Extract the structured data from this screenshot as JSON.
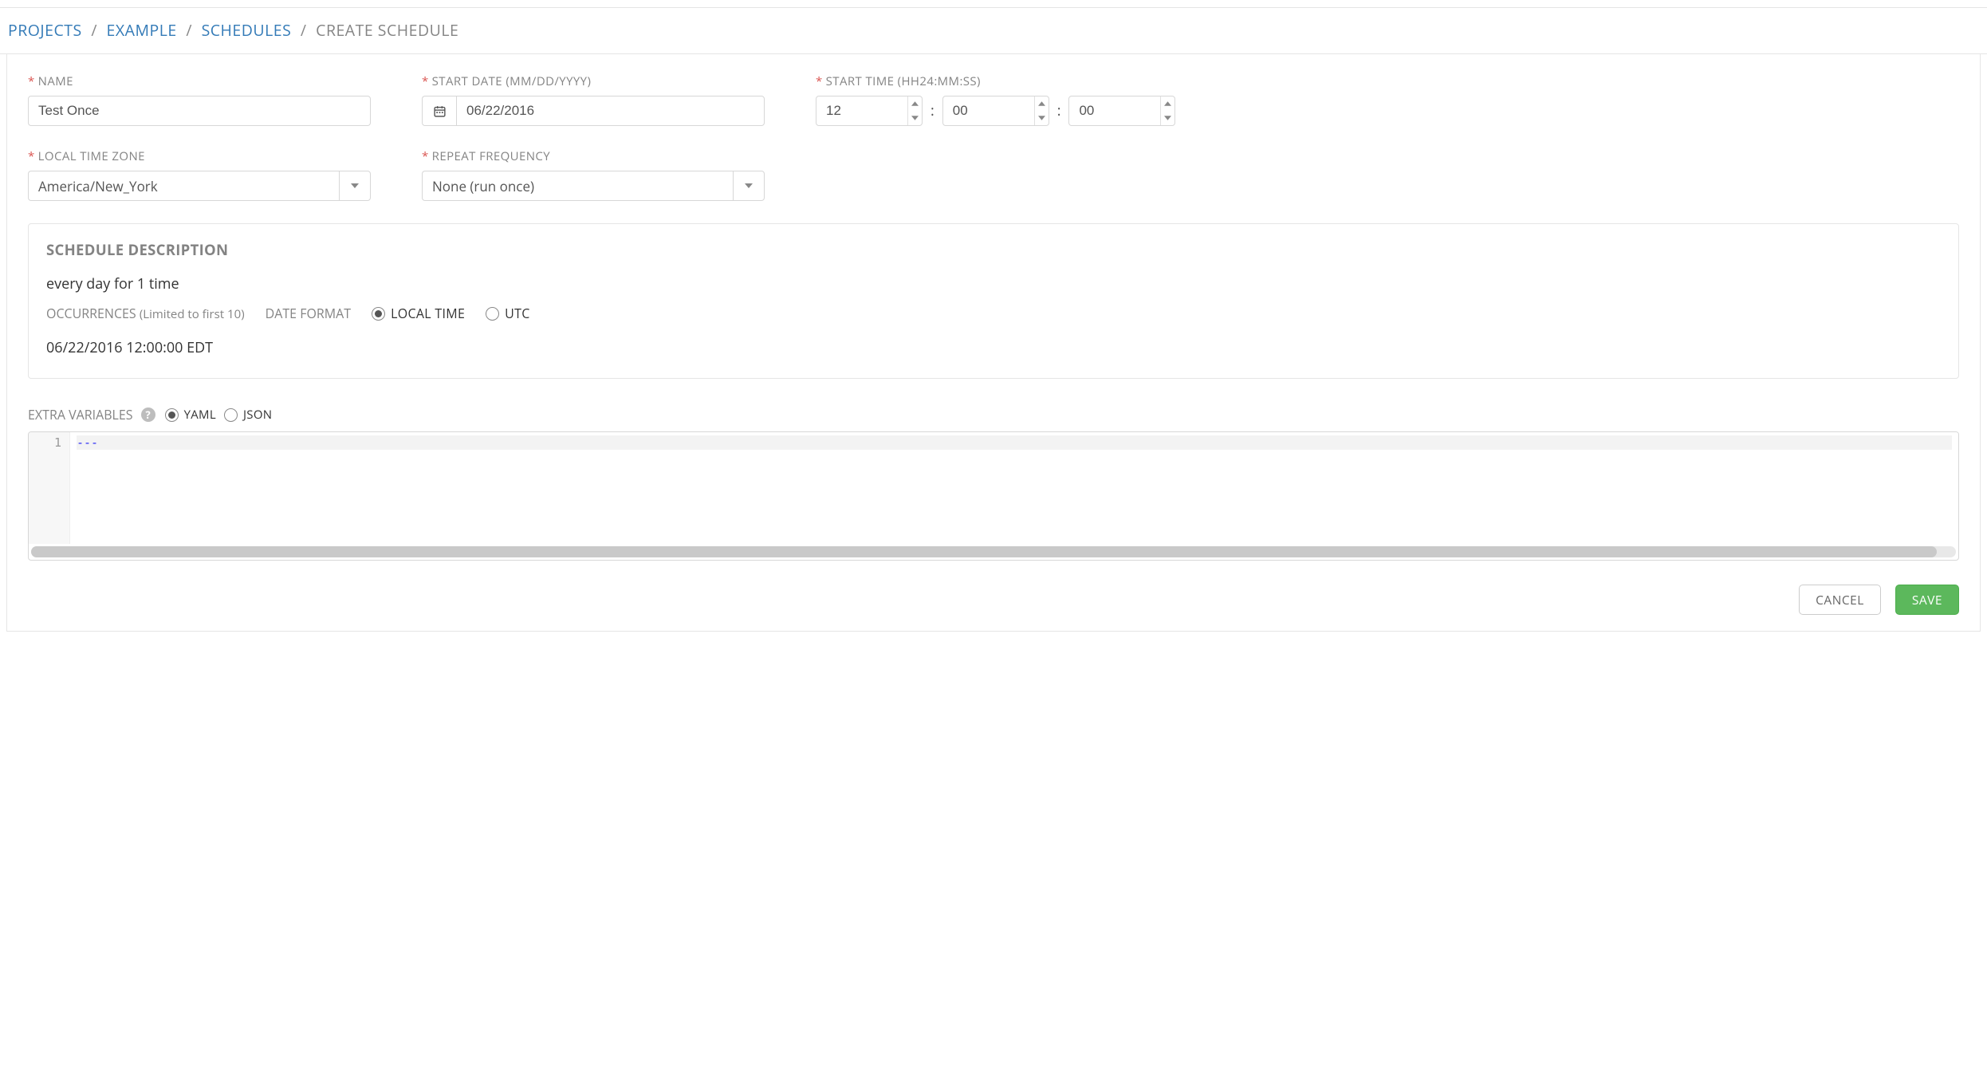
{
  "breadcrumb": {
    "projects": "PROJECTS",
    "example": "EXAMPLE",
    "schedules": "SCHEDULES",
    "current": "CREATE SCHEDULE"
  },
  "form": {
    "name_label": "NAME",
    "name_value": "Test Once",
    "start_date_label": "START DATE (MM/DD/YYYY)",
    "start_date_value": "06/22/2016",
    "start_time_label": "START TIME (HH24:MM:SS)",
    "hour": "12",
    "minute": "00",
    "second": "00",
    "tz_label": "LOCAL TIME ZONE",
    "tz_value": "America/New_York",
    "freq_label": "REPEAT FREQUENCY",
    "freq_value": "None (run once)"
  },
  "description": {
    "title": "SCHEDULE DESCRIPTION",
    "summary": "every day for 1 time",
    "occurrences_label": "OCCURRENCES",
    "occurrences_hint": "(Limited to first 10)",
    "date_format_label": "DATE FORMAT",
    "local_label": "LOCAL TIME",
    "utc_label": "UTC",
    "occurrences": [
      "06/22/2016 12:00:00 EDT"
    ]
  },
  "extras": {
    "label": "EXTRA VARIABLES",
    "yaml_label": "YAML",
    "json_label": "JSON",
    "line_no": "1",
    "content": "---"
  },
  "actions": {
    "cancel": "CANCEL",
    "save": "SAVE"
  }
}
